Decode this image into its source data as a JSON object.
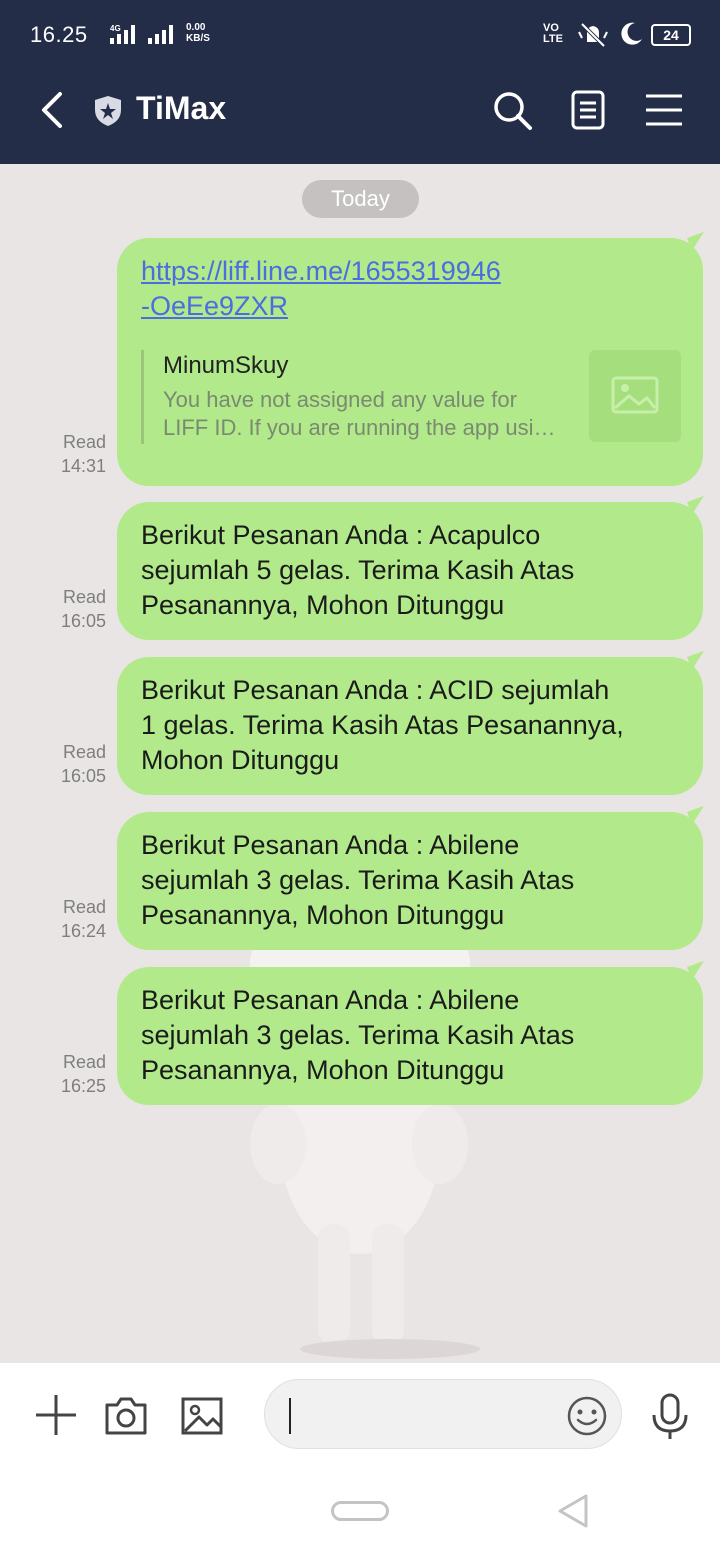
{
  "status_bar": {
    "time": "16.25",
    "net_speed_value": "0.00",
    "net_speed_unit": "KB/S",
    "volte_line1": "VO",
    "volte_line2": "LTE",
    "battery": "24"
  },
  "header": {
    "title": "TiMax"
  },
  "chat": {
    "date_label": "Today",
    "messages": [
      {
        "type": "link",
        "link_line1": "https://liff.line.me/1655319946",
        "link_line2": "-OeEe9ZXR",
        "preview_title": "MinumSkuy",
        "preview_desc_line1": "You have not assigned any value for",
        "preview_desc_line2": "LIFF ID. If you are running the app usi…",
        "status": "Read",
        "time": "14:31"
      },
      {
        "type": "text",
        "lines": [
          "Berikut Pesanan Anda : Acapulco",
          "sejumlah 5 gelas. Terima Kasih Atas",
          "Pesanannya, Mohon Ditunggu"
        ],
        "status": "Read",
        "time": "16:05"
      },
      {
        "type": "text",
        "lines": [
          "Berikut Pesanan Anda : ACID sejumlah",
          "1 gelas. Terima Kasih Atas Pesanannya,",
          "Mohon Ditunggu"
        ],
        "status": "Read",
        "time": "16:05"
      },
      {
        "type": "text",
        "lines": [
          "Berikut Pesanan Anda : Abilene",
          "sejumlah 3 gelas. Terima Kasih Atas",
          "Pesanannya, Mohon Ditunggu"
        ],
        "status": "Read",
        "time": "16:24"
      },
      {
        "type": "text",
        "lines": [
          "Berikut Pesanan Anda : Abilene",
          "sejumlah 3 gelas. Terima Kasih Atas",
          "Pesanannya, Mohon Ditunggu"
        ],
        "status": "Read",
        "time": "16:25"
      }
    ]
  },
  "input": {
    "value": "",
    "placeholder": ""
  },
  "colors": {
    "header_bg": "#242d48",
    "chat_bg": "#e9e5e5",
    "bubble_bg": "#b2ea8b",
    "link": "#4b6de0"
  },
  "icons": {
    "back": "chevron-left-icon",
    "shield": "shield-star-icon",
    "search": "search-icon",
    "notes": "notes-icon",
    "menu": "hamburger-menu-icon",
    "plus": "plus-icon",
    "camera": "camera-icon",
    "image": "image-icon",
    "emoji": "emoji-icon",
    "mic": "microphone-icon"
  }
}
